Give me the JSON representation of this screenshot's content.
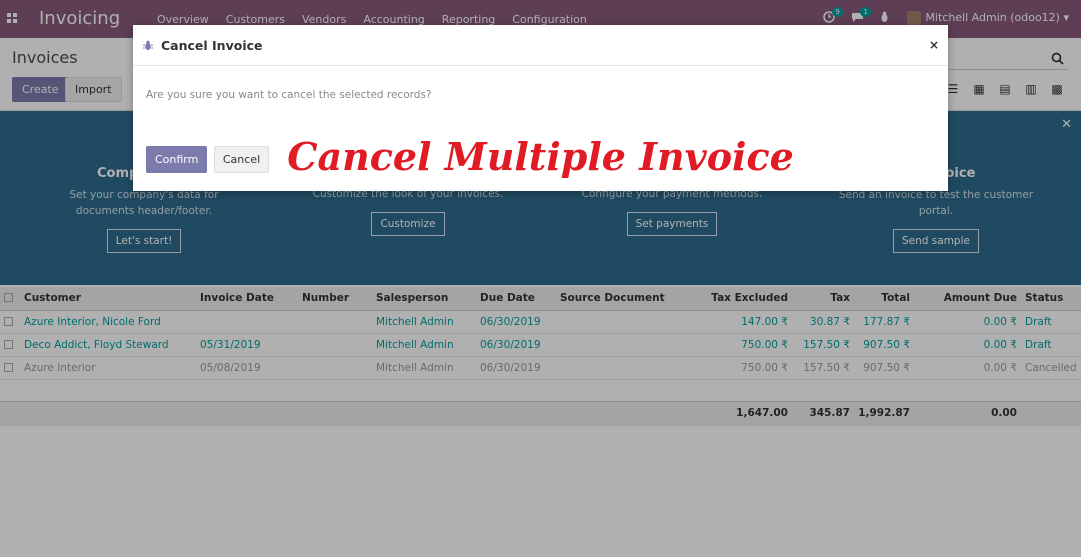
{
  "navbar": {
    "app_title": "Invoicing",
    "menu": [
      "Overview",
      "Customers",
      "Vendors",
      "Accounting",
      "Reporting",
      "Configuration"
    ],
    "activity_count": "9",
    "message_count": "1",
    "user": "Mitchell Admin (odoo12)"
  },
  "control_panel": {
    "breadcrumb": "Invoices",
    "create_label": "Create",
    "import_label": "Import"
  },
  "banner": {
    "steps": [
      {
        "title": "Comp",
        "desc": "Set your company's data for documents header/footer.",
        "button": "Let's start!"
      },
      {
        "title": "",
        "desc": "Customize the look of your invoices.",
        "button": "Customize"
      },
      {
        "title": "",
        "desc": "Configure your payment methods.",
        "button": "Set payments"
      },
      {
        "title": "voice",
        "desc": "Send an invoice to test the customer portal.",
        "button": "Send sample"
      }
    ]
  },
  "table": {
    "columns": [
      "Customer",
      "Invoice Date",
      "Number",
      "Salesperson",
      "Due Date",
      "Source Document",
      "Tax Excluded",
      "Tax",
      "Total",
      "Amount Due",
      "Status"
    ],
    "rows": [
      {
        "customer": "Azure Interior, Nicole Ford",
        "invoice_date": "",
        "number": "",
        "salesperson": "Mitchell Admin",
        "due_date": "06/30/2019",
        "source": "",
        "tax_excluded": "147.00 ₹",
        "tax": "30.87 ₹",
        "total": "177.87 ₹",
        "amount_due": "0.00 ₹",
        "status": "Draft"
      },
      {
        "customer": "Deco Addict, Floyd Steward",
        "invoice_date": "05/31/2019",
        "number": "",
        "salesperson": "Mitchell Admin",
        "due_date": "06/30/2019",
        "source": "",
        "tax_excluded": "750.00 ₹",
        "tax": "157.50 ₹",
        "total": "907.50 ₹",
        "amount_due": "0.00 ₹",
        "status": "Draft"
      },
      {
        "customer": "Azure Interior",
        "invoice_date": "05/08/2019",
        "number": "",
        "salesperson": "Mitchell Admin",
        "due_date": "06/30/2019",
        "source": "",
        "tax_excluded": "750.00 ₹",
        "tax": "157.50 ₹",
        "total": "907.50 ₹",
        "amount_due": "0.00 ₹",
        "status": "Cancelled"
      }
    ],
    "totals": {
      "tax_excluded": "1,647.00",
      "tax": "345.87",
      "total": "1,992.87",
      "amount_due": "0.00"
    }
  },
  "modal": {
    "title": "Cancel Invoice",
    "body": "Are you sure you want to cancel the selected records?",
    "confirm_label": "Confirm",
    "cancel_label": "Cancel",
    "close_glyph": "×"
  },
  "overlay_caption": "Cancel Multiple Invoice",
  "colors": {
    "brand": "#875a7b",
    "primary_button": "#7c7bad",
    "link": "#00a09d",
    "banner": "#2f6c8d",
    "caption": "#e01b24"
  }
}
